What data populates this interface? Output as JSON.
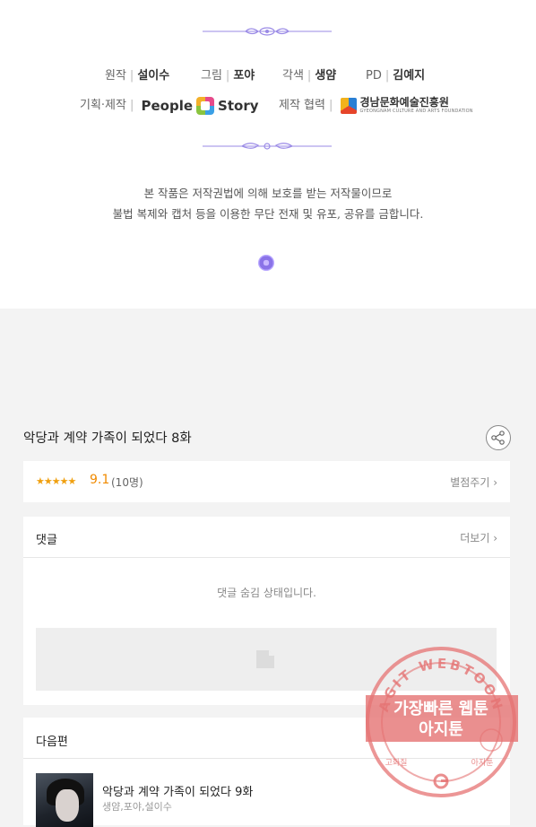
{
  "credits": {
    "original": {
      "label": "원작",
      "value": "설이수"
    },
    "art": {
      "label": "그림",
      "value": "포야"
    },
    "adaptation": {
      "label": "각색",
      "value": "생얌"
    },
    "pd": {
      "label": "PD",
      "value": "김예지"
    },
    "planning": {
      "label": "기획·제작",
      "logo_left": "People",
      "logo_right": "Story"
    },
    "cooperation": {
      "label": "제작 협력",
      "logo_main": "경남문화예술진흥원",
      "logo_sub": "GYEONGNAM CULTURE AND ARTS FOUNDATION"
    }
  },
  "notice": {
    "line1": "본 작품은 저작권법에 의해 보호를 받는 저작물이므로",
    "line2": "불법 복제와 캡처 등을 이용한 무단 전재 및 유포, 공유를 금합니다."
  },
  "episode": {
    "title": "악당과 계약 가족이 되었다 8화"
  },
  "rating": {
    "stars": "★★★★★",
    "score": "9.1",
    "count": "(10명)",
    "rate_link": "별점주기 ›",
    "star_fraction": 0.91
  },
  "comments": {
    "title": "댓글",
    "more": "더보기 ›",
    "hidden_message": "댓글 숨김 상태입니다."
  },
  "next": {
    "title": "다음편",
    "episode_title": "악당과 계약 가족이 되었다 9화",
    "authors": "생얌,포야,설이수"
  },
  "watermark": {
    "top_arc": "AGIT WEBTOON",
    "line1": "가장빠른 웹툰",
    "line2": "아지툰",
    "bottom_left": "고화질",
    "bottom_right": "아지툰",
    "color": "#e57373"
  },
  "colors": {
    "accent_orange": "#f08a00",
    "ornament_purple": "#9a8ae6"
  },
  "icons": {
    "share": "share-icon",
    "chevron": "chevron-right-icon",
    "doc": "document-icon",
    "ornament": "flourish-ornament"
  }
}
